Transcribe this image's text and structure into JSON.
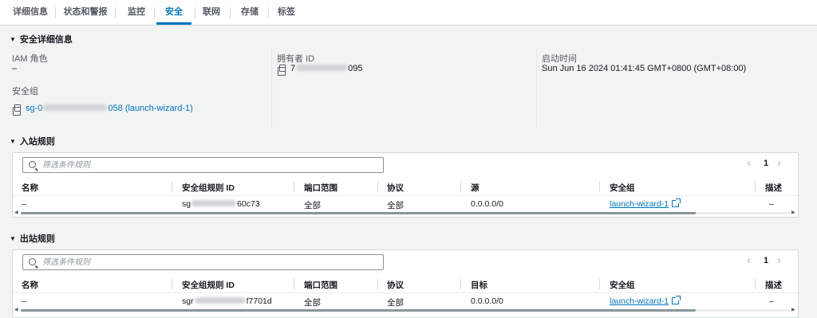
{
  "tabs": [
    {
      "label": "详细信息"
    },
    {
      "label": "状态和警报"
    },
    {
      "label": "监控"
    },
    {
      "label": "安全"
    },
    {
      "label": "联网"
    },
    {
      "label": "存储"
    },
    {
      "label": "标签"
    }
  ],
  "active_tab": "安全",
  "security_details": {
    "heading": "安全详细信息",
    "iam_role_label": "IAM 角色",
    "iam_role_value": "–",
    "owner_id_label": "拥有者 ID",
    "owner_id_prefix": "7",
    "owner_id_suffix": "095",
    "launch_time_label": "启动时间",
    "launch_time_value": "Sun Jun 16 2024 01:41:45 GMT+0800 (GMT+08:00)",
    "security_groups_label": "安全组",
    "security_group_prefix": "sg-0",
    "security_group_suffix": "058 (launch-wizard-1)"
  },
  "inbound": {
    "heading": "入站规则",
    "filter_placeholder": "筛选条件规则",
    "page": "1",
    "prev_icon": "‹",
    "next_icon": "›",
    "columns": [
      "名称",
      "安全组规则 ID",
      "端口范围",
      "协议",
      "源",
      "安全组",
      "描述"
    ],
    "row": {
      "name": "–",
      "rule_id_prefix": "sg",
      "rule_id_suffix": "60c73",
      "port_range": "全部",
      "protocol": "全部",
      "source": "0.0.0.0/0",
      "security_group": "launch-wizard-1",
      "description": "–"
    }
  },
  "outbound": {
    "heading": "出站规则",
    "filter_placeholder": "筛选条件规则",
    "page": "1",
    "prev_icon": "‹",
    "next_icon": "›",
    "columns": [
      "名称",
      "安全组规则 ID",
      "端口范围",
      "协议",
      "目标",
      "安全组",
      "描述"
    ],
    "row": {
      "name": "–",
      "rule_id_prefix": "sgr",
      "rule_id_suffix": "f7701d",
      "port_range": "全部",
      "protocol": "全部",
      "destination": "0.0.0.0/0",
      "security_group": "launch-wizard-1",
      "description": "–"
    }
  },
  "colors": {
    "accent": "#0073bb",
    "text": "#16191f",
    "muted": "#545b64",
    "background": "#f2f3f3"
  },
  "icons": {
    "caret": "▼",
    "copy": "copy-icon",
    "search": "search-icon",
    "external_link": "external-link-icon",
    "scroll_left": "◀",
    "scroll_right": "▶"
  }
}
